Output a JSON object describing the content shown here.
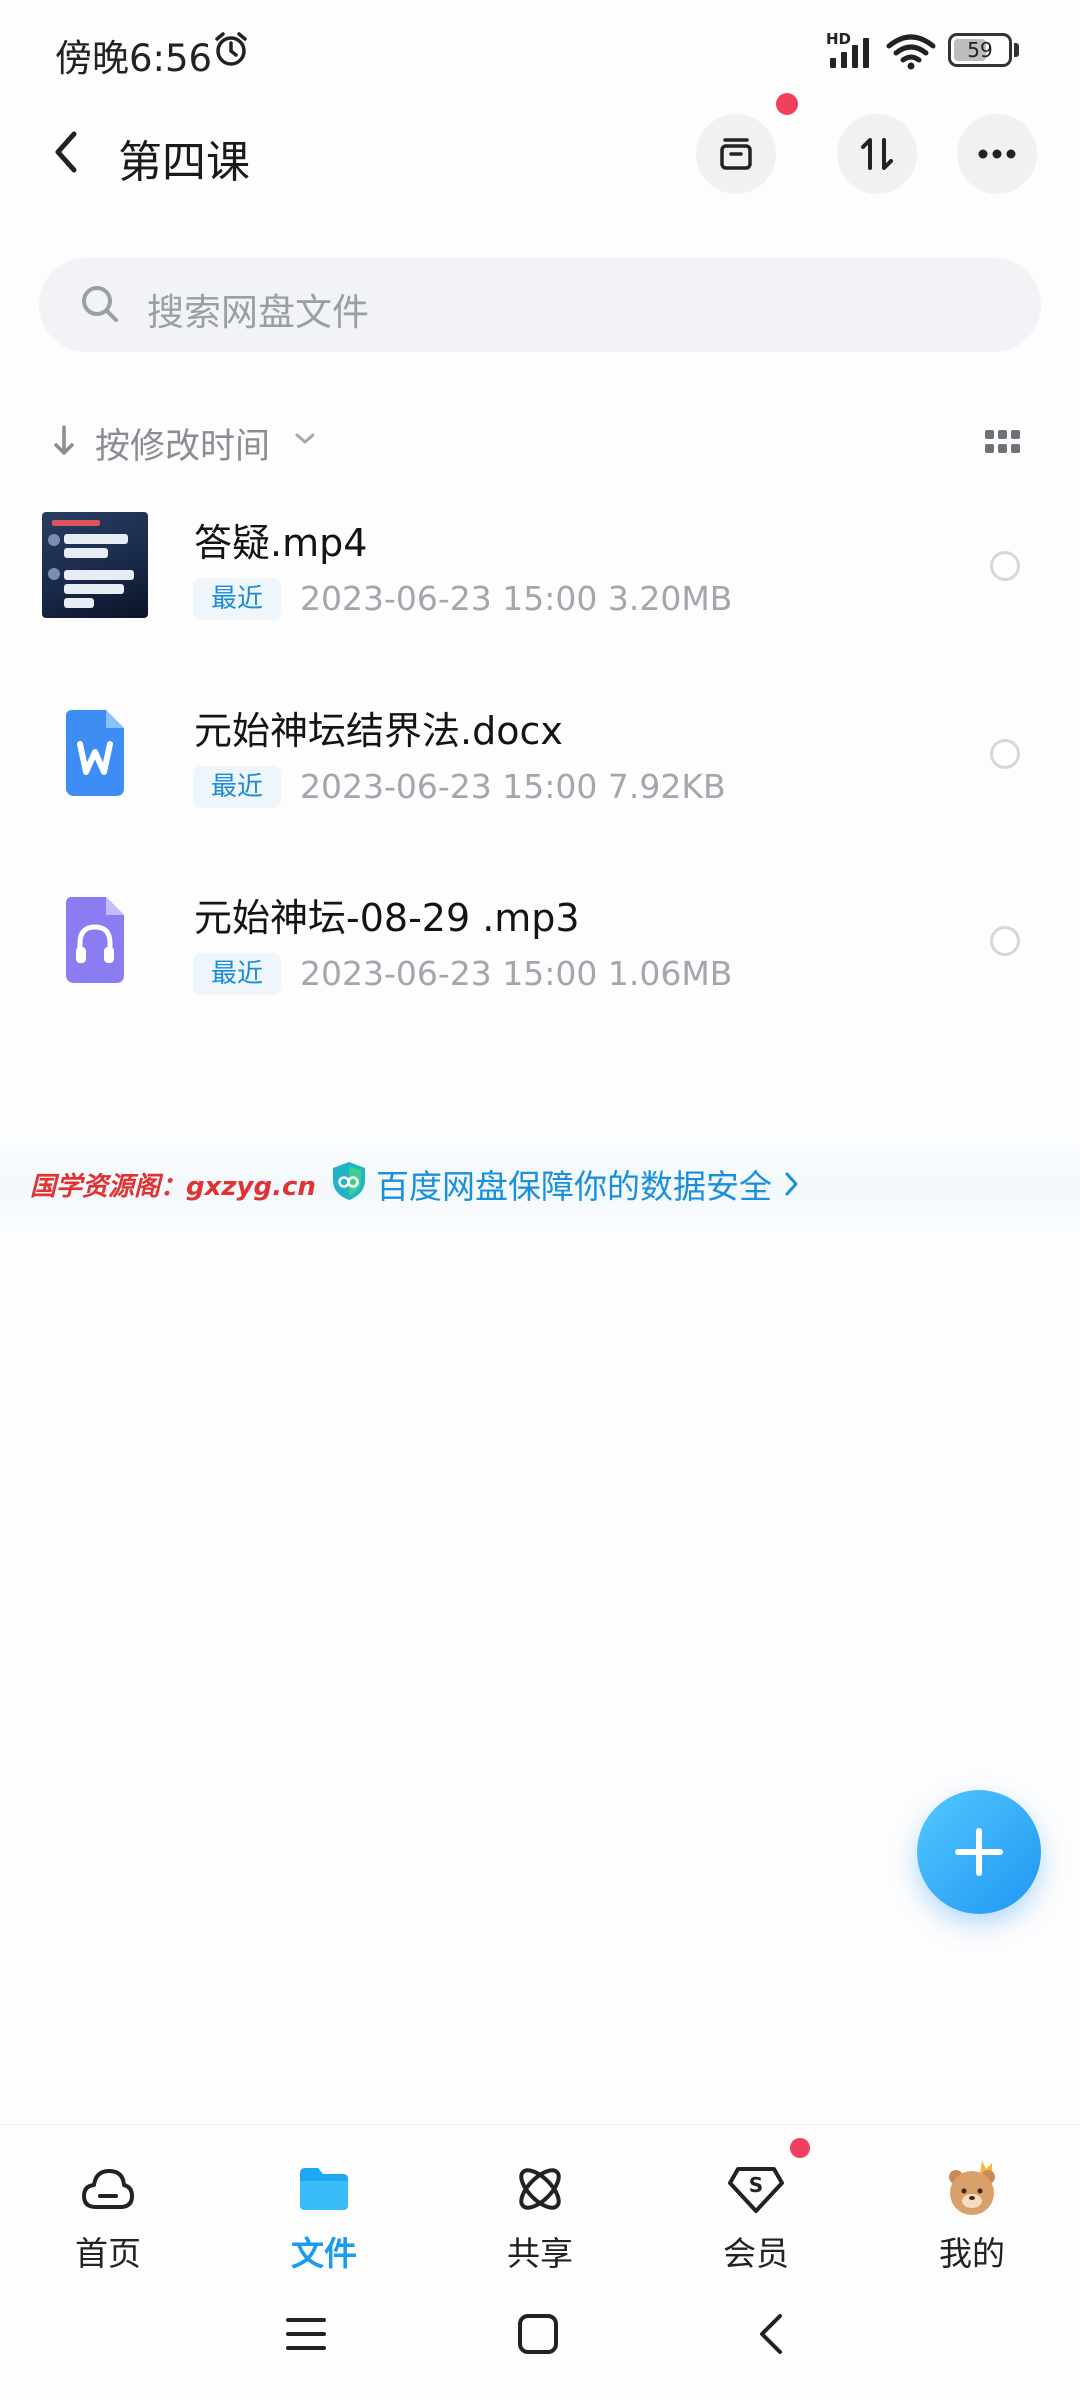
{
  "status_bar": {
    "time": "傍晚6:56",
    "network": "HD",
    "wifi_sub": "6",
    "battery": "59"
  },
  "header": {
    "title": "第四课"
  },
  "search": {
    "placeholder": "搜索网盘文件"
  },
  "sort": {
    "label": "按修改时间"
  },
  "files": [
    {
      "name": "答疑.mp4",
      "badge": "最近",
      "meta": "2023-06-23  15:00  3.20MB",
      "type": "video"
    },
    {
      "name": "元始神坛结界法.docx",
      "badge": "最近",
      "meta": "2023-06-23  15:00  7.92KB",
      "type": "word"
    },
    {
      "name": "元始神坛-08-29 .mp3",
      "badge": "最近",
      "meta": "2023-06-23  15:00  1.06MB",
      "type": "audio"
    }
  ],
  "banner": {
    "watermark": "国学资源阁：gxzyg.cn",
    "text": "百度网盘保障你的数据安全"
  },
  "bottom_nav": [
    {
      "label": "首页",
      "active": false
    },
    {
      "label": "文件",
      "active": true
    },
    {
      "label": "共享",
      "active": false
    },
    {
      "label": "会员",
      "active": false
    },
    {
      "label": "我的",
      "active": false
    }
  ],
  "colors": {
    "accent": "#1b9af0",
    "badge_text": "#1b8bd6",
    "notification_dot": "#f0405e",
    "watermark": "#e03333"
  }
}
